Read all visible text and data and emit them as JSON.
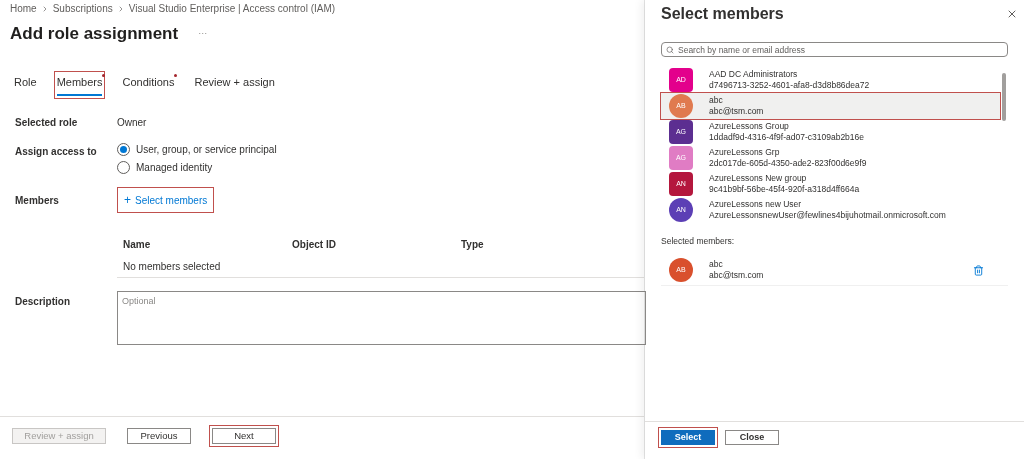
{
  "breadcrumb": [
    "Home",
    "Subscriptions",
    "Visual Studio Enterprise | Access control (IAM)"
  ],
  "title": "Add role assignment",
  "more": "···",
  "tabs": [
    {
      "label": "Role",
      "selected": false,
      "required": false,
      "highlighted": false
    },
    {
      "label": "Members",
      "selected": true,
      "required": true,
      "highlighted": true
    },
    {
      "label": "Conditions",
      "selected": false,
      "required": true,
      "highlighted": false
    },
    {
      "label": "Review + assign",
      "selected": false,
      "required": false,
      "highlighted": false
    }
  ],
  "selected_role": {
    "label": "Selected role",
    "value": "Owner"
  },
  "assign_access": {
    "label": "Assign access to",
    "options": [
      {
        "label": "User, group, or service principal",
        "selected": true
      },
      {
        "label": "Managed identity",
        "selected": false
      }
    ]
  },
  "members": {
    "label": "Members",
    "button": "Select members",
    "button_icon": "+",
    "highlighted": true
  },
  "table": {
    "columns": [
      "Name",
      "Object ID",
      "Type"
    ],
    "empty": "No members selected"
  },
  "description": {
    "label": "Description",
    "placeholder": "Optional"
  },
  "footer": [
    {
      "label": "Review + assign",
      "disabled": true,
      "highlighted": false
    },
    {
      "label": "Previous",
      "disabled": false,
      "highlighted": false
    },
    {
      "label": "Next",
      "disabled": false,
      "highlighted": true
    }
  ],
  "panel": {
    "title": "Select members",
    "search": {
      "placeholder": "Search by name or email address"
    },
    "results": [
      {
        "initials": "AD",
        "name": "AAD DC Administrators",
        "detail": "d7496713-3252-4601-afa8-d3d8b86dea72",
        "kind": "group",
        "color": "#e3008c",
        "selected": false,
        "highlighted": false
      },
      {
        "initials": "AB",
        "name": "abc",
        "detail": "abc@tsm.com",
        "kind": "user",
        "color": "#e07a4f",
        "selected": true,
        "highlighted": true
      },
      {
        "initials": "AG",
        "name": "AzureLessons Group",
        "detail": "1ddadf9d-4316-4f9f-ad07-c3109ab2b16e",
        "kind": "group",
        "color": "#5c2e91",
        "selected": false,
        "highlighted": false
      },
      {
        "initials": "AG",
        "name": "AzureLessons Grp",
        "detail": "2dc017de-605d-4350-ade2-823f00d6e9f9",
        "kind": "group",
        "color": "#e07cc4",
        "selected": false,
        "highlighted": false
      },
      {
        "initials": "AN",
        "name": "AzureLessons New group",
        "detail": "9c41b9bf-56be-45f4-920f-a318d4ff664a",
        "kind": "group",
        "color": "#b4173d",
        "selected": false,
        "highlighted": false
      },
      {
        "initials": "AN",
        "name": "AzureLessons new User",
        "detail": "AzureLessonsnewUser@fewlines4bijuhotmail.onmicrosoft.com",
        "kind": "user",
        "color": "#5c3fb5",
        "selected": false,
        "highlighted": false
      }
    ],
    "selected_label": "Selected members:",
    "selected": [
      {
        "initials": "AB",
        "name": "abc",
        "detail": "abc@tsm.com",
        "kind": "user",
        "color": "#d9502d"
      }
    ],
    "buttons": [
      {
        "label": "Select",
        "primary": true,
        "highlighted": true
      },
      {
        "label": "Close",
        "primary": false,
        "highlighted": false
      }
    ]
  }
}
